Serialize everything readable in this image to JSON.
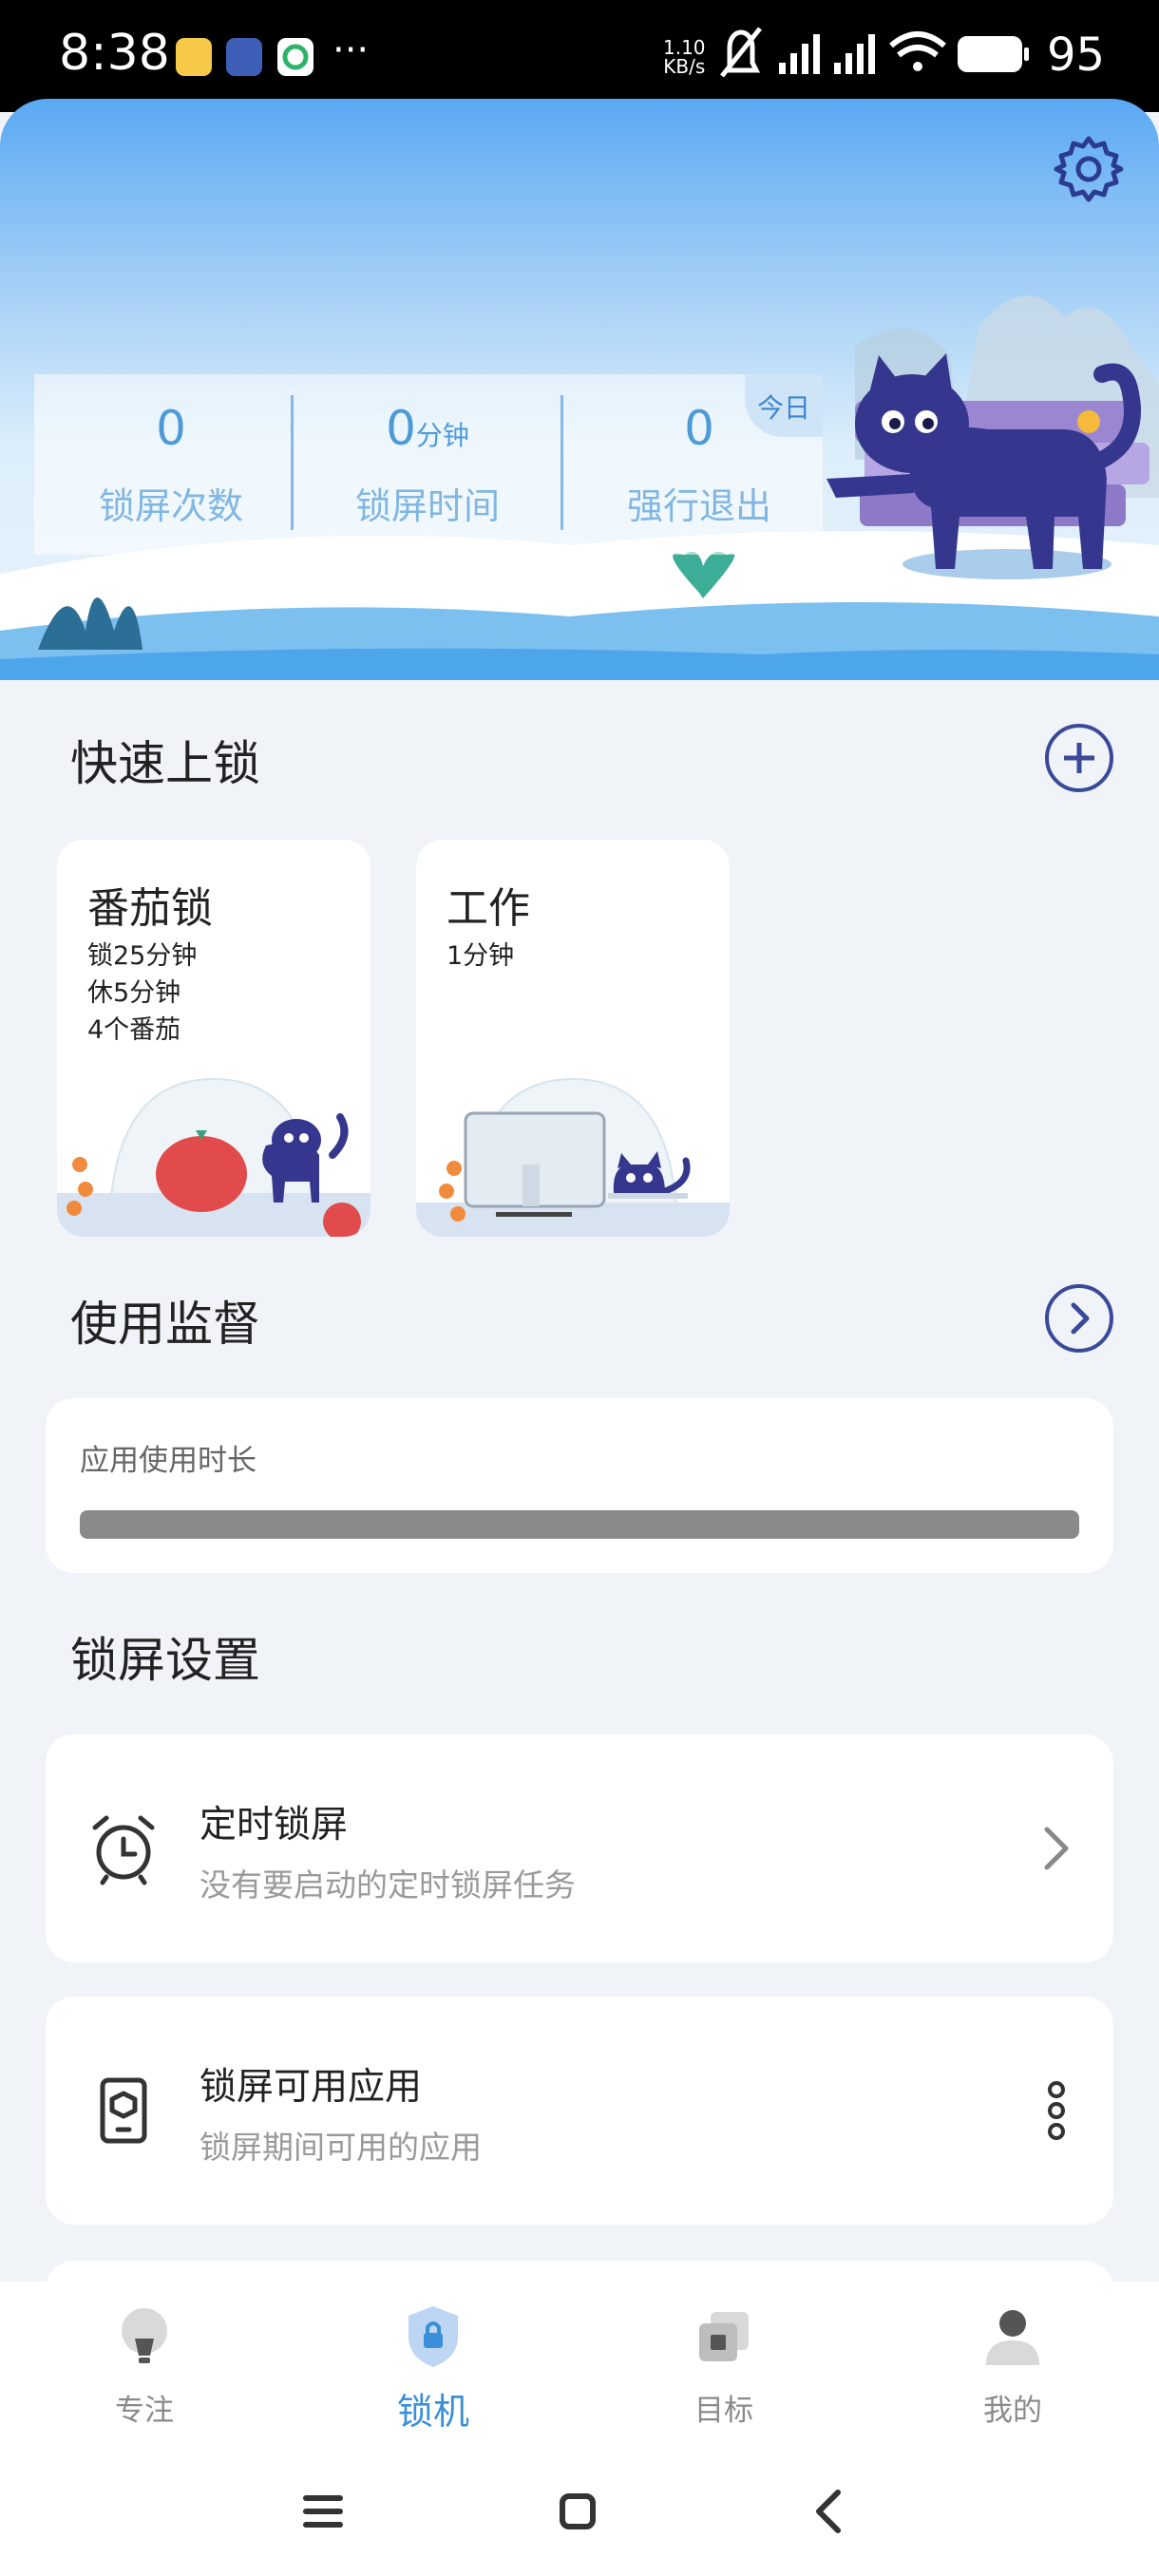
{
  "status_bar": {
    "time": "8:38",
    "net_speed_value": "1.10",
    "net_speed_unit": "KB/s",
    "battery": "95"
  },
  "header": {
    "today_tag": "今日",
    "stats": [
      {
        "value": "0",
        "unit": "",
        "label": "锁屏次数"
      },
      {
        "value": "0",
        "unit": "分钟",
        "label": "锁屏时间"
      },
      {
        "value": "0",
        "unit": "",
        "label": "强行退出"
      }
    ]
  },
  "quick_lock": {
    "title": "快速上锁",
    "cards": [
      {
        "title": "番茄锁",
        "lines": [
          "锁25分钟",
          "休5分钟",
          "4个番茄"
        ]
      },
      {
        "title": "工作",
        "lines": [
          "1分钟"
        ]
      }
    ]
  },
  "usage": {
    "title": "使用监督",
    "label": "应用使用时长"
  },
  "lock_settings": {
    "title": "锁屏设置",
    "items": [
      {
        "title": "定时锁屏",
        "subtitle": "没有要启动的定时锁屏任务"
      },
      {
        "title": "锁屏可用应用",
        "subtitle": "锁屏期间可用的应用"
      }
    ]
  },
  "bottom_nav": [
    {
      "label": "专注",
      "icon": "bulb-icon"
    },
    {
      "label": "锁机",
      "icon": "lock-shield-icon",
      "active": true
    },
    {
      "label": "目标",
      "icon": "target-layers-icon"
    },
    {
      "label": "我的",
      "icon": "person-icon"
    }
  ],
  "colors": {
    "accent": "#3a8fd9",
    "dark_accent": "#3a4a9a",
    "background": "#f0f3f7"
  }
}
